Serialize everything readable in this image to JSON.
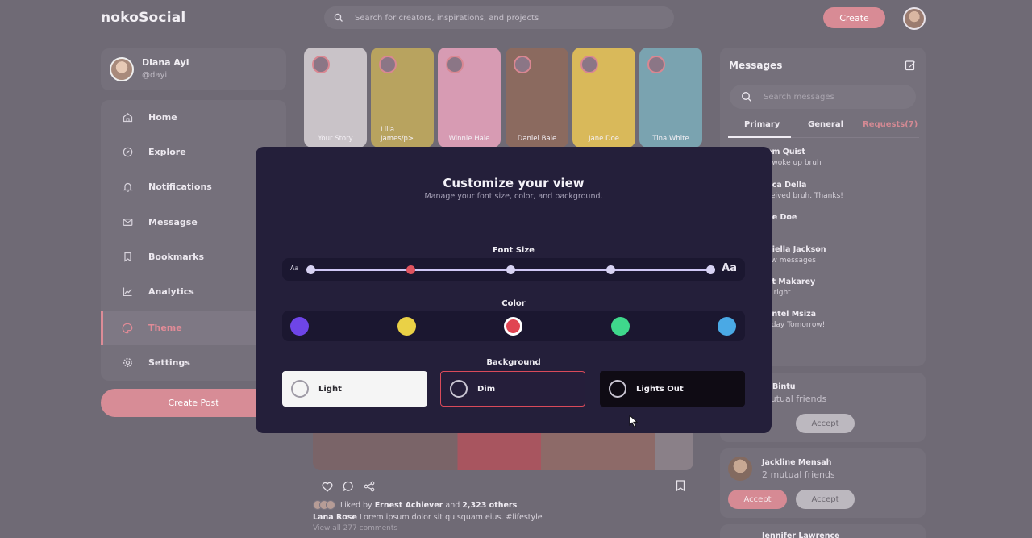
{
  "app": {
    "logo": "nokoSocial",
    "search_placeholder": "Search for creators, inspirations, and projects",
    "create_label": "Create"
  },
  "profile": {
    "name": "Diana Ayi",
    "handle": "@dayi"
  },
  "sidebar": {
    "items": [
      {
        "label": "Home",
        "icon": "home-icon"
      },
      {
        "label": "Explore",
        "icon": "compass-icon"
      },
      {
        "label": "Notifications",
        "icon": "bell-icon"
      },
      {
        "label": "Messagse",
        "icon": "envelope-icon"
      },
      {
        "label": "Bookmarks",
        "icon": "bookmark-icon"
      },
      {
        "label": "Analytics",
        "icon": "chart-icon"
      },
      {
        "label": "Theme",
        "icon": "palette-icon",
        "active": true
      },
      {
        "label": "Settings",
        "icon": "gear-icon"
      }
    ],
    "create_post_label": "Create Post"
  },
  "stories": [
    {
      "name": "Your Story",
      "bg": "#c9c3c8"
    },
    {
      "name": "Lilla James/p>",
      "bg": "#b8a35f"
    },
    {
      "name": "Winnie Hale",
      "bg": "#d79bb3"
    },
    {
      "name": "Daniel Bale",
      "bg": "#8b6a5f"
    },
    {
      "name": "Jane Doe",
      "bg": "#d9b95a"
    },
    {
      "name": "Tina White",
      "bg": "#7aa3b0"
    }
  ],
  "post": {
    "liked_prefix": "Liked by",
    "liked_name": "Ernest Achiever",
    "liked_middle": "and",
    "liked_count": "2,323 others",
    "caption_author": "Lana Rose",
    "caption_text": "Lorem ipsum dolor sit quisquam eius. #lifestyle",
    "comments_link": "View all 277 comments"
  },
  "messages": {
    "title": "Messages",
    "search_placeholder": "Search messages",
    "tabs": {
      "primary": "Primary",
      "general": "General",
      "requests": "Requests(7)"
    },
    "items": [
      {
        "name": "em Quist",
        "text": "t woke up bruh"
      },
      {
        "name": "nca Della",
        "text": "ceived bruh. Thanks!"
      },
      {
        "name": "ne Doe",
        "text": ""
      },
      {
        "name": "niella Jackson",
        "text": "ew messages"
      },
      {
        "name": "et Makarey",
        "text": "u right"
      },
      {
        "name": "antel Msiza",
        "text": "hday Tomorrow!"
      }
    ]
  },
  "requests": [
    {
      "name": "ja Bintu",
      "mutual": "mutual friends",
      "accept_label": "Accept"
    },
    {
      "name": "Jackline Mensah",
      "mutual": "2 mutual friends",
      "accept_label": "Accept",
      "decline_label": "Accept"
    },
    {
      "name": "Jennifer Lawrence"
    }
  ],
  "modal": {
    "title": "Customize your view",
    "subtitle": "Manage your font size, color, and background.",
    "font_size": {
      "label": "Font Size",
      "small_label": "Aa",
      "large_label": "Aa",
      "steps": 5,
      "selected_step": 2
    },
    "color": {
      "label": "Color",
      "options": [
        "#6e45e8",
        "#ead146",
        "#e04452",
        "#3fd88c",
        "#4aa9e5"
      ],
      "selected_index": 2
    },
    "background": {
      "label": "Background",
      "options": [
        "Light",
        "Dim",
        "Lights Out"
      ],
      "selected": "Dim"
    }
  }
}
